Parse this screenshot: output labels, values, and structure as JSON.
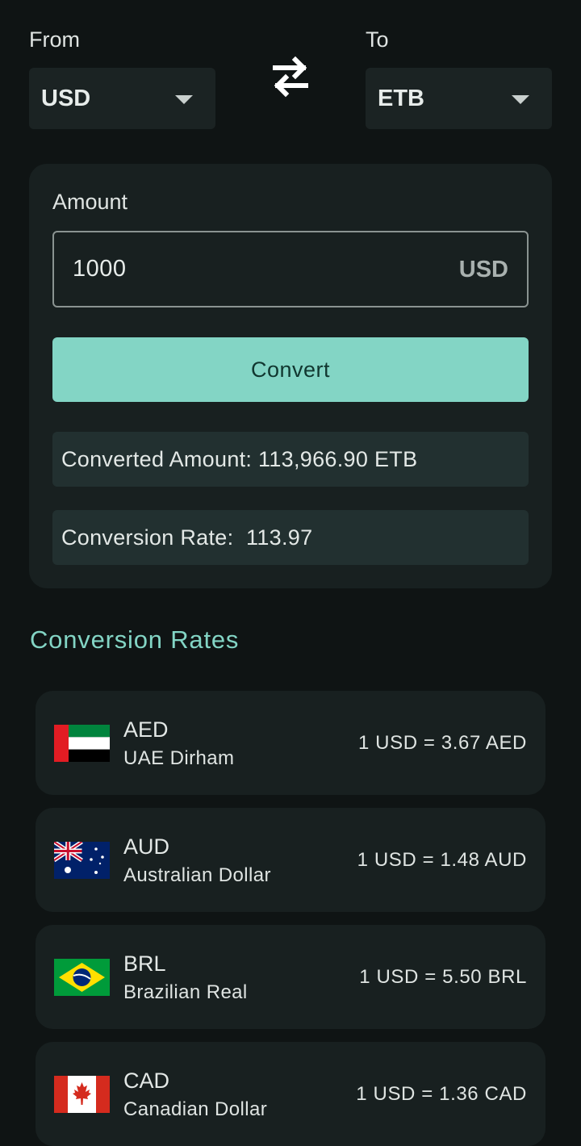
{
  "converter": {
    "from_label": "From",
    "to_label": "To",
    "from_currency": "USD",
    "to_currency": "ETB",
    "swap_icon": "swap-horizontal-icon"
  },
  "amount": {
    "label": "Amount",
    "value": "1000",
    "suffix": "USD"
  },
  "convert_button": "Convert",
  "result": {
    "converted_amount": "Converted Amount: 113,966.90 ETB",
    "conversion_rate": "Conversion Rate:  113.97"
  },
  "rates_section": {
    "title": "Conversion Rates",
    "items": [
      {
        "code": "AED",
        "name": "UAE Dirham",
        "rate": "1 USD = 3.67 AED",
        "flag": "uae-flag-icon"
      },
      {
        "code": "AUD",
        "name": "Australian Dollar",
        "rate": "1 USD = 1.48 AUD",
        "flag": "australia-flag-icon"
      },
      {
        "code": "BRL",
        "name": "Brazilian Real",
        "rate": "1 USD = 5.50 BRL",
        "flag": "brazil-flag-icon"
      },
      {
        "code": "CAD",
        "name": "Canadian Dollar",
        "rate": "1 USD = 1.36 CAD",
        "flag": "canada-flag-icon"
      }
    ]
  },
  "colors": {
    "background": "#0f1414",
    "card": "#182020",
    "accent": "#83d5c5",
    "info_box": "#223030"
  }
}
